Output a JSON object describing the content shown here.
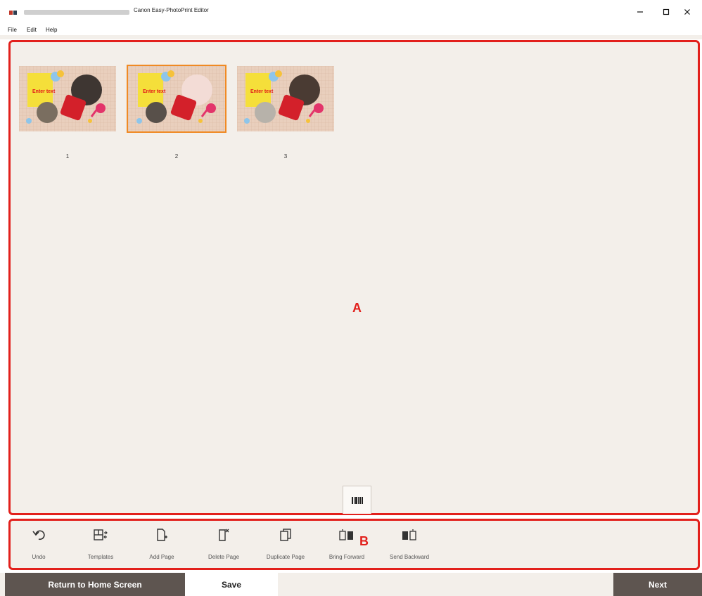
{
  "window": {
    "title": "Canon Easy-PhotoPrint Editor"
  },
  "menu": {
    "items": [
      {
        "label": "File"
      },
      {
        "label": "Edit"
      },
      {
        "label": "Help"
      }
    ]
  },
  "pages": [
    {
      "number": "1",
      "placeholder_text": "Enter text",
      "selected": false
    },
    {
      "number": "2",
      "placeholder_text": "Enter text",
      "selected": true
    },
    {
      "number": "3",
      "placeholder_text": "Enter text",
      "selected": false
    }
  ],
  "markers": {
    "a": "A",
    "b": "B"
  },
  "toolbar": {
    "tools": [
      {
        "label": "Undo",
        "icon": "undo-icon"
      },
      {
        "label": "Templates",
        "icon": "templates-icon"
      },
      {
        "label": "Add Page",
        "icon": "add-page-icon"
      },
      {
        "label": "Delete Page",
        "icon": "delete-page-icon"
      },
      {
        "label": "Duplicate Page",
        "icon": "duplicate-page-icon"
      },
      {
        "label": "Bring Forward",
        "icon": "bring-forward-icon"
      },
      {
        "label": "Send Backward",
        "icon": "send-backward-icon"
      }
    ]
  },
  "bottom": {
    "return_label": "Return to Home Screen",
    "save_label": "Save",
    "next_label": "Next"
  },
  "colors": {
    "annotation_red": "#e2201c",
    "selection_orange": "#f08a24",
    "button_dark": "#5e5550",
    "canvas_bg": "#f3efea"
  }
}
